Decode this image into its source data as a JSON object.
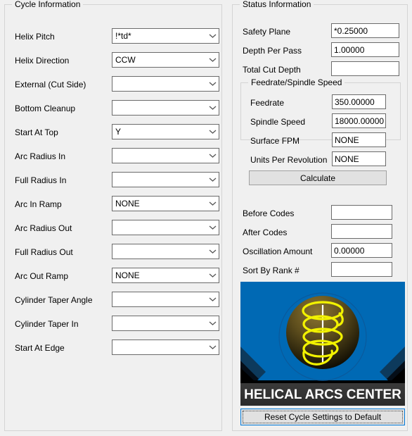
{
  "cycle": {
    "title": "Cycle Information",
    "fields": [
      {
        "label": "Helix Pitch",
        "value": "!*td*",
        "type": "combo"
      },
      {
        "label": "Helix Direction",
        "value": "CCW",
        "type": "combo"
      },
      {
        "label": "External (Cut Side)",
        "value": "",
        "type": "combo"
      },
      {
        "label": "Bottom Cleanup",
        "value": "",
        "type": "combo"
      },
      {
        "label": "Start At Top",
        "value": "Y",
        "type": "combo"
      },
      {
        "label": "Arc Radius In",
        "value": "",
        "type": "combo"
      },
      {
        "label": "Full Radius In",
        "value": "",
        "type": "combo"
      },
      {
        "label": "Arc In Ramp",
        "value": "NONE",
        "type": "combo"
      },
      {
        "label": "Arc Radius Out",
        "value": "",
        "type": "combo"
      },
      {
        "label": "Full Radius Out",
        "value": "",
        "type": "combo"
      },
      {
        "label": "Arc Out Ramp",
        "value": "NONE",
        "type": "combo"
      },
      {
        "label": "Cylinder Taper Angle",
        "value": "",
        "type": "combo"
      },
      {
        "label": "Cylinder Taper In",
        "value": "",
        "type": "combo"
      },
      {
        "label": "Start At Edge",
        "value": "",
        "type": "combo"
      }
    ]
  },
  "status": {
    "title": "Status Information",
    "fields": [
      {
        "label": "Safety Plane",
        "value": "*0.25000"
      },
      {
        "label": "Depth Per Pass",
        "value": "1.00000"
      },
      {
        "label": "Total Cut Depth",
        "value": ""
      }
    ],
    "feed_group": {
      "title": "Feedrate/Spindle Speed",
      "fields": [
        {
          "label": "Feedrate",
          "value": "350.00000"
        },
        {
          "label": "Spindle Speed",
          "value": "18000.00000"
        },
        {
          "label": "Surface FPM",
          "value": "NONE"
        },
        {
          "label": "Units Per Revolution",
          "value": "NONE"
        }
      ],
      "calculate_label": "Calculate"
    },
    "extra_fields": [
      {
        "label": "Before Codes",
        "value": ""
      },
      {
        "label": "After Codes",
        "value": ""
      },
      {
        "label": "Oscillation Amount",
        "value": "0.00000"
      },
      {
        "label": "Sort By Rank #",
        "value": ""
      }
    ],
    "logo": {
      "banner_text": "HELICAL ARCS CENTER",
      "blue": "#0069b4",
      "dark_blue": "#0d3a5c",
      "black": "#000000",
      "banner_bg": "#333333",
      "helix_color": "#f2f200",
      "sphere_top": "#6e5c22"
    },
    "reset_button_label": "Reset Cycle Settings to Default"
  }
}
